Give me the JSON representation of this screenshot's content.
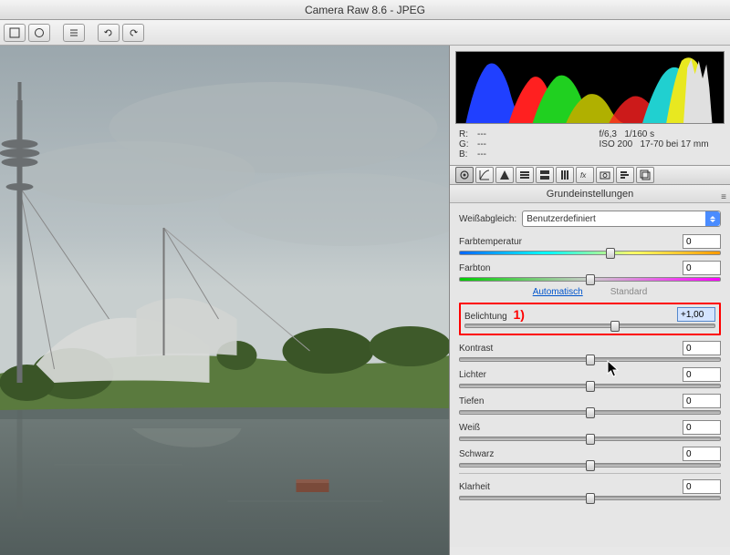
{
  "window_title": "Camera Raw 8.6 - JPEG",
  "histogram_info": {
    "r_label": "R:",
    "r_value": "---",
    "g_label": "G:",
    "g_value": "---",
    "b_label": "B:",
    "b_value": "---",
    "aperture": "f/6,3",
    "shutter": "1/160 s",
    "iso": "ISO 200",
    "lens": "17-70 bei 17 mm"
  },
  "panel_title": "Grundeinstellungen",
  "wb": {
    "label": "Weißabgleich:",
    "value": "Benutzerdefiniert"
  },
  "sliders": {
    "temperature": {
      "label": "Farbtemperatur",
      "value": "0",
      "pos": 58
    },
    "tint": {
      "label": "Farbton",
      "value": "0",
      "pos": 50
    },
    "exposure": {
      "label": "Belichtung",
      "value": "+1,00",
      "pos": 60,
      "annotation": "1)"
    },
    "contrast": {
      "label": "Kontrast",
      "value": "0",
      "pos": 50
    },
    "highlights": {
      "label": "Lichter",
      "value": "0",
      "pos": 50
    },
    "shadows": {
      "label": "Tiefen",
      "value": "0",
      "pos": 50
    },
    "whites": {
      "label": "Weiß",
      "value": "0",
      "pos": 50
    },
    "blacks": {
      "label": "Schwarz",
      "value": "0",
      "pos": 50
    },
    "clarity": {
      "label": "Klarheit",
      "value": "0",
      "pos": 50
    }
  },
  "links": {
    "auto": "Automatisch",
    "standard": "Standard"
  }
}
